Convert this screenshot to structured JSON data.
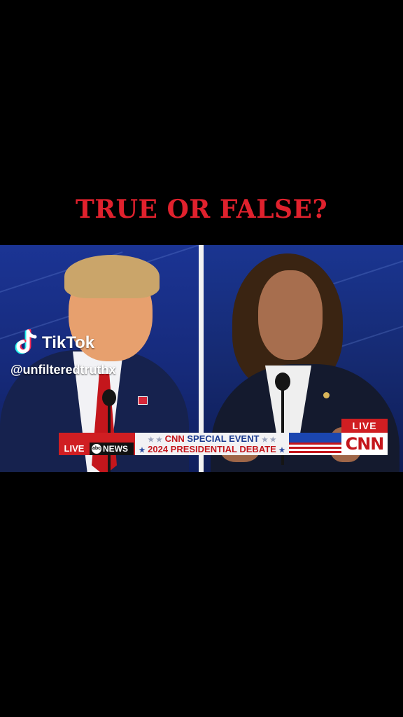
{
  "headline": {
    "text": "TRUE OR FALSE?",
    "color": "#e0212d"
  },
  "watermark": {
    "brand": "TikTok",
    "handle": "@unfilteredtruthx",
    "icon": "tiktok-note-icon"
  },
  "broadcast": {
    "left_bug": {
      "live": "LIVE",
      "network_logo": "abc",
      "network": "NEWS"
    },
    "title_line1_brand": "CNN",
    "title_line1": "SPECIAL EVENT",
    "title_line2": "2024 PRESIDENTIAL DEBATE",
    "live_tag": "LIVE",
    "cnn_logo": "CNN",
    "colors": {
      "red": "#d01e22",
      "blue": "#1b46b0"
    }
  }
}
